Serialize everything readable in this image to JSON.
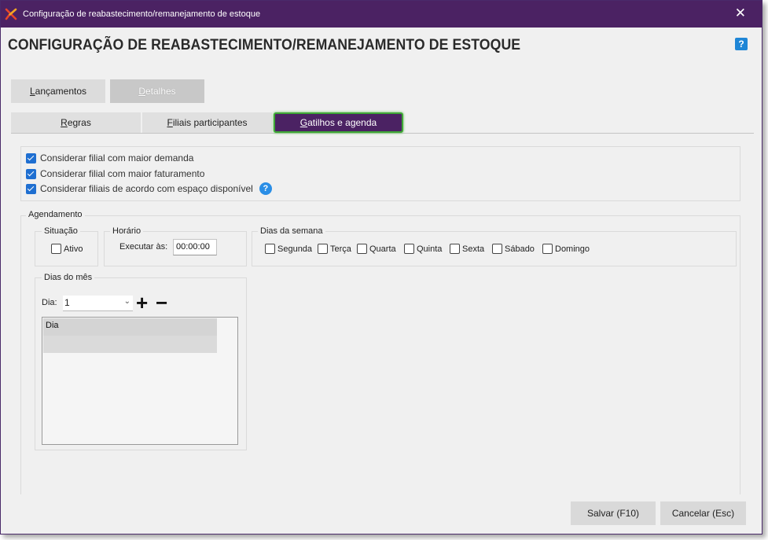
{
  "window": {
    "title": "Configuração de reabastecimento/remanejamento de estoque",
    "close_glyph": "✕",
    "accent_color": "#4b2263",
    "logo_icon": "x-logo-icon"
  },
  "header": {
    "title": "CONFIGURAÇÃO DE REABASTECIMENTO/REMANEJAMENTO DE ESTOQUE",
    "help_label": "?"
  },
  "top_tabs": {
    "lancamentos_hotkey": "L",
    "lancamentos_rest": "ançamentos",
    "detalhes_hotkey": "D",
    "detalhes_rest": "etalhes"
  },
  "sub_tabs": {
    "regras_hotkey": "R",
    "regras_rest": "egras",
    "filiais_hotkey": "F",
    "filiais_rest": "iliais participantes",
    "gatilhos_hotkey": "G",
    "gatilhos_rest": "atilhos e agenda",
    "active_color": "#4b2263",
    "active_border": "#3fa837"
  },
  "options": [
    {
      "label": "Considerar filial com maior demanda",
      "checked": true
    },
    {
      "label": "Considerar filial com maior faturamento",
      "checked": true
    },
    {
      "label": "Considerar filiais de acordo com espaço disponível",
      "checked": true,
      "help": "?"
    }
  ],
  "agendamento": {
    "legend": "Agendamento",
    "situacao": {
      "legend": "Situação",
      "ativo_label": "Ativo",
      "ativo_checked": false
    },
    "horario": {
      "legend": "Horário",
      "executar_label": "Executar às:",
      "time_value": "00:00:00"
    },
    "dias_semana": {
      "legend": "Dias da semana",
      "days": [
        "Segunda",
        "Terça",
        "Quarta",
        "Quinta",
        "Sexta",
        "Sábado",
        "Domingo"
      ]
    },
    "dias_mes": {
      "legend": "Dias do mês",
      "dia_label": "Dia:",
      "dia_value": "1",
      "plus": "+",
      "minus": "−",
      "grid_header": "Dia"
    }
  },
  "footer": {
    "save_label": "Salvar (F10)",
    "cancel_label": "Cancelar (Esc)"
  }
}
